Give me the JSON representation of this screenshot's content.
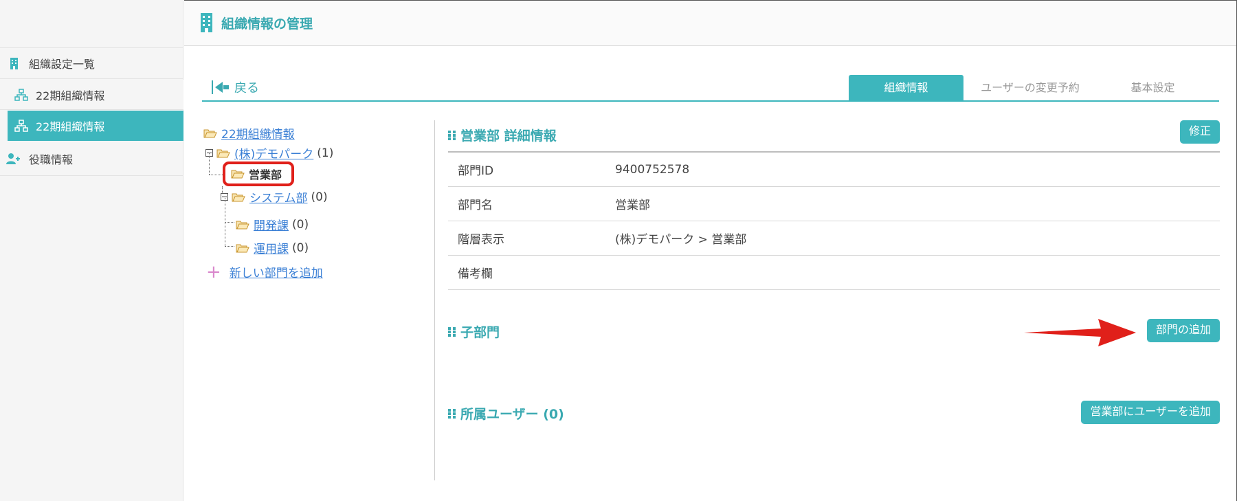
{
  "header": {
    "title": "組織情報の管理"
  },
  "sidebar": {
    "heading": "組織設定一覧",
    "items": [
      {
        "label": "22期組織情報"
      },
      {
        "label": "22期組織情報"
      },
      {
        "label": "役職情報"
      }
    ]
  },
  "nav": {
    "back_label": "戻る",
    "tabs": [
      {
        "label": "組織情報"
      },
      {
        "label": "ユーザーの変更予約"
      },
      {
        "label": "基本設定"
      }
    ]
  },
  "tree": {
    "root": "22期組織情報",
    "company": {
      "label": "(株)デモパーク",
      "count": "(1)"
    },
    "selected": "営業部",
    "system": {
      "label": "システム部",
      "count": "(0)"
    },
    "dev": {
      "label": "開発課",
      "count": "(0)"
    },
    "ops": {
      "label": "運用課",
      "count": "(0)"
    },
    "add_label": "新しい部門を追加"
  },
  "detail": {
    "title": "営業部 詳細情報",
    "edit_label": "修正",
    "rows": [
      {
        "key": "部門ID",
        "value": "9400752578"
      },
      {
        "key": "部門名",
        "value": "営業部"
      },
      {
        "key": "階層表示",
        "value": "(株)デモパーク > 営業部"
      },
      {
        "key": "備考欄",
        "value": ""
      }
    ],
    "children_title": "子部門",
    "add_child_label": "部門の追加",
    "users_title": "所属ユーザー (0)",
    "add_user_label": "営業部にユーザーを追加"
  },
  "colors": {
    "accent": "#3db6bd",
    "link": "#3a7fd5",
    "highlight": "#e0201a"
  }
}
